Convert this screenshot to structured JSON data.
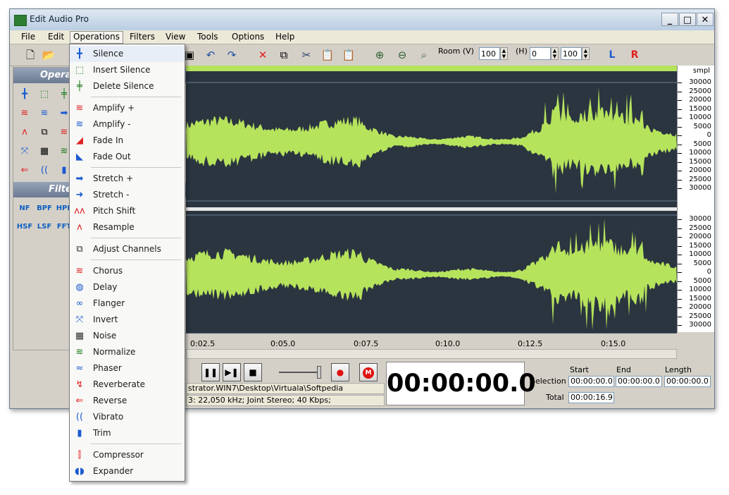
{
  "window": {
    "title": "Edit Audio Pro"
  },
  "menubar": [
    "File",
    "Edit",
    "Operations",
    "Filters",
    "View",
    "Tools",
    "Options",
    "Help"
  ],
  "toolbar": {
    "room_label": "Room (V)",
    "room_value": "100",
    "h_label": "(H)",
    "h_value": "0",
    "h_zoom": "100",
    "left_channel": "L",
    "right_channel": "R"
  },
  "left_panel": {
    "operations_header": "Operations",
    "filters_header": "Filters",
    "filters": [
      "NF",
      "BPF",
      "HPF",
      "HSF",
      "LSF",
      "FFT"
    ]
  },
  "scale": {
    "unit": "smpl",
    "labels": [
      "30000",
      "25000",
      "20000",
      "15000",
      "10000",
      "5000",
      "0",
      "5000",
      "10000",
      "15000",
      "20000",
      "25000",
      "30000"
    ]
  },
  "ruler": [
    "0:02.5",
    "0:05.0",
    "0:07.5",
    "0:10.0",
    "0:12.5",
    "0:15.0"
  ],
  "status": {
    "path": "strator.WIN7\\Desktop\\Virtuala\\Softpedia",
    "format": "3: 22,050 kHz; Joint Stereo; 40 Kbps;"
  },
  "time_display": "00:00:00.0",
  "selection": {
    "start_label": "Start",
    "end_label": "End",
    "length_label": "Length",
    "selection_label": "Selection",
    "total_label": "Total",
    "start": "00:00:00.0",
    "end": "00:00:00.0",
    "length": "00:00:00.0",
    "total": "00:00:16.9"
  },
  "colors": {
    "waveform": "#b6e35c",
    "wave_bg": "#2b3540",
    "window_frame": "#d4d0c8"
  },
  "operations_menu": [
    {
      "label": "Silence",
      "icon": "silence-icon",
      "highlight": true
    },
    {
      "label": "Insert Silence",
      "icon": "insert-silence-icon"
    },
    {
      "label": "Delete Silence",
      "icon": "delete-silence-icon"
    },
    {
      "sep": true
    },
    {
      "label": "Amplify +",
      "icon": "amplify-plus-icon"
    },
    {
      "label": "Amplify -",
      "icon": "amplify-minus-icon"
    },
    {
      "label": "Fade In",
      "icon": "fade-in-icon"
    },
    {
      "label": "Fade Out",
      "icon": "fade-out-icon"
    },
    {
      "sep": true
    },
    {
      "label": "Stretch +",
      "icon": "stretch-plus-icon"
    },
    {
      "label": "Stretch -",
      "icon": "stretch-minus-icon"
    },
    {
      "label": "Pitch Shift",
      "icon": "pitch-shift-icon"
    },
    {
      "label": "Resample",
      "icon": "resample-icon"
    },
    {
      "sep": true
    },
    {
      "label": "Adjust Channels",
      "icon": "adjust-channels-icon"
    },
    {
      "sep": true
    },
    {
      "label": "Chorus",
      "icon": "chorus-icon"
    },
    {
      "label": "Delay",
      "icon": "delay-icon"
    },
    {
      "label": "Flanger",
      "icon": "flanger-icon"
    },
    {
      "label": "Invert",
      "icon": "invert-icon"
    },
    {
      "label": "Noise",
      "icon": "noise-icon"
    },
    {
      "label": "Normalize",
      "icon": "normalize-icon"
    },
    {
      "label": "Phaser",
      "icon": "phaser-icon"
    },
    {
      "label": "Reverberate",
      "icon": "reverberate-icon"
    },
    {
      "label": "Reverse",
      "icon": "reverse-icon"
    },
    {
      "label": "Vibrato",
      "icon": "vibrato-icon"
    },
    {
      "label": "Trim",
      "icon": "trim-icon"
    },
    {
      "sep": true
    },
    {
      "label": "Compressor",
      "icon": "compressor-icon"
    },
    {
      "label": "Expander",
      "icon": "expander-icon"
    }
  ]
}
